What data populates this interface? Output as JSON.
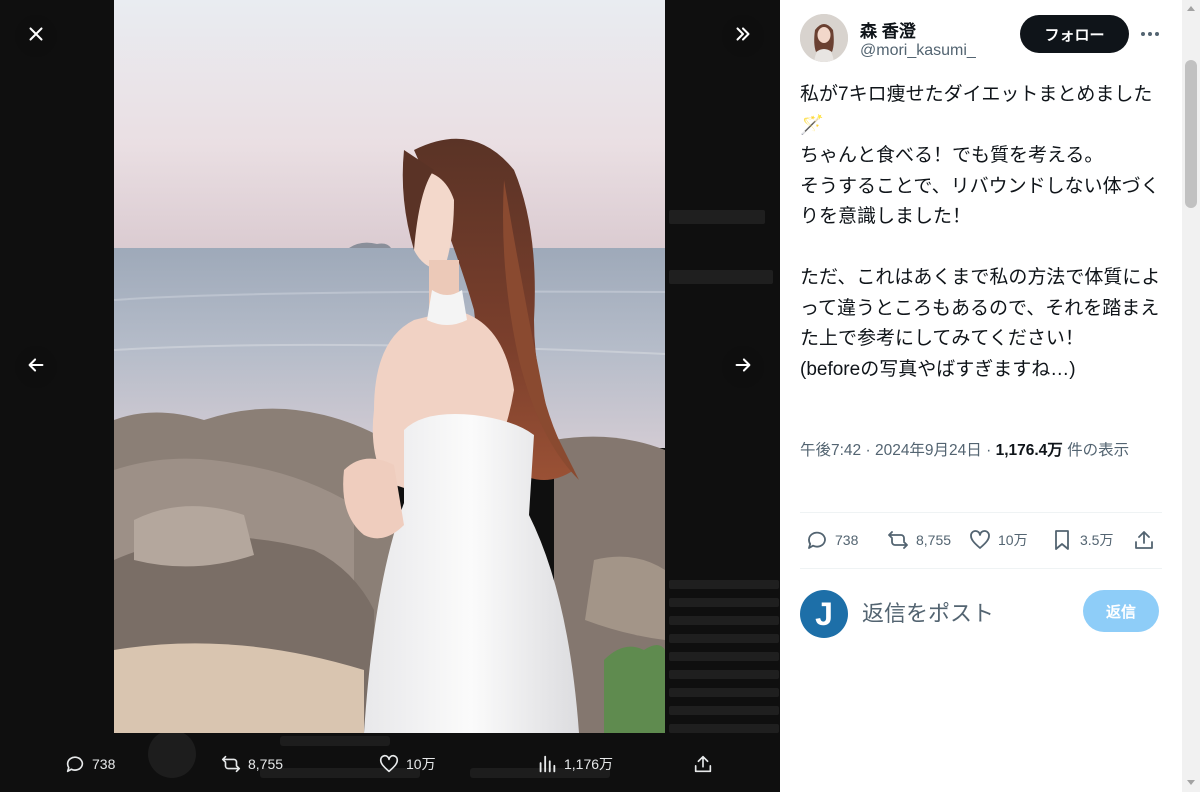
{
  "viewer": {
    "close_icon": "close-icon",
    "expand_icon": "chevron-double-right-icon",
    "prev_icon": "arrow-left-icon",
    "next_icon": "arrow-right-icon",
    "actions": {
      "replies": "738",
      "reposts": "8,755",
      "likes": "10万",
      "views": "1,176万"
    }
  },
  "author": {
    "name": "森 香澄",
    "handle": "@mori_kasumi_",
    "follow_label": "フォロー"
  },
  "tweet": {
    "text": "私が7キロ痩せたダイエットまとめました🪄\nちゃんと食べる！でも質を考える。\nそうすることで、リバウンドしない体づくりを意識しました！\n\nただ、これはあくまで私の方法で体質によって違うところもあるので、それを踏まえた上で参考にしてみてください！\n(beforeの写真やばすぎますね…)",
    "time": "午後7:42",
    "date": "2024年9月24日",
    "views_count": "1,176.4万",
    "views_suffix": "件の表示"
  },
  "actions": {
    "replies": "738",
    "reposts": "8,755",
    "likes": "10万",
    "bookmarks": "3.5万"
  },
  "reply": {
    "avatar_letter": "J",
    "placeholder": "返信をポスト",
    "button_label": "返信"
  },
  "colors": {
    "viewer_bg": "#0f0f0f",
    "follow_bg": "#0f1419",
    "reply_button_bg": "#8ecdf8",
    "avatar_bg": "#1d6fa8",
    "secondary_text": "#536471"
  }
}
